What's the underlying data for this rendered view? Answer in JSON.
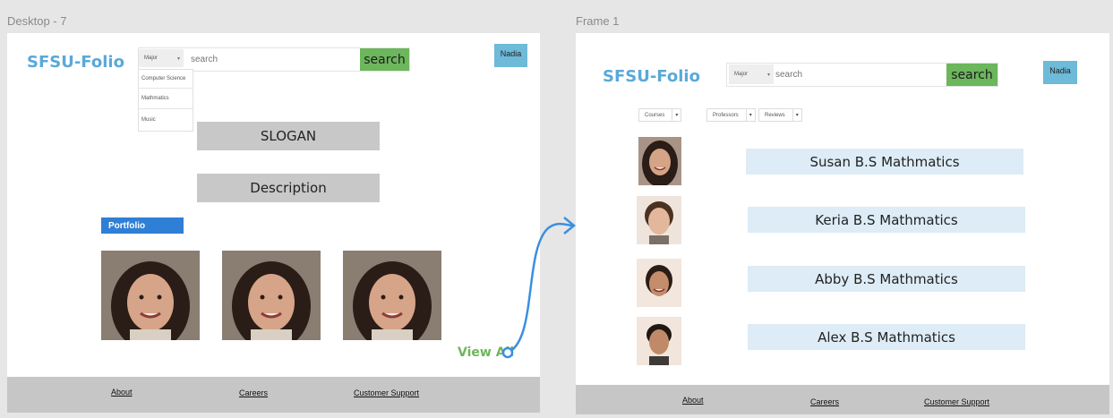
{
  "frames": {
    "left_label": "Desktop - 7",
    "right_label": "Frame 1"
  },
  "left": {
    "logo": "SFSU-Folio",
    "major_select": "Major",
    "search_placeholder": "search",
    "search_button": "search",
    "user_button": "Nadia",
    "dropdown_options": [
      "Computer Science",
      "Mathmatics",
      "Music"
    ],
    "slogan": "SLOGAN",
    "description": "Description",
    "portfolio_button": "Portfolio",
    "view_all": "View All"
  },
  "right": {
    "logo": "SFSU-Folio",
    "major_select": "Major",
    "search_placeholder": "search",
    "search_button": "search",
    "user_button": "Nadia",
    "filters": [
      "Courses",
      "Professors",
      "Reviews"
    ],
    "results": [
      "Susan B.S Mathmatics",
      "Keria B.S  Mathmatics",
      "Abby  B.S  Mathmatics",
      "Alex  B.S  Mathmatics"
    ]
  },
  "footer": {
    "about": "About",
    "careers": "Careers",
    "support": "Customer Support"
  },
  "colors": {
    "logo": "#5aa9d8",
    "search_button": "#6cb65c",
    "user_button": "#6ebad9",
    "portfolio_button": "#2f7fd6",
    "result_card": "#ddecf6",
    "footer": "#c6c6c6",
    "connector": "#3b8fe0"
  },
  "icons": {
    "select_chevron": "chevron-down-icon",
    "prototype_link": "arrow-connector-icon"
  }
}
